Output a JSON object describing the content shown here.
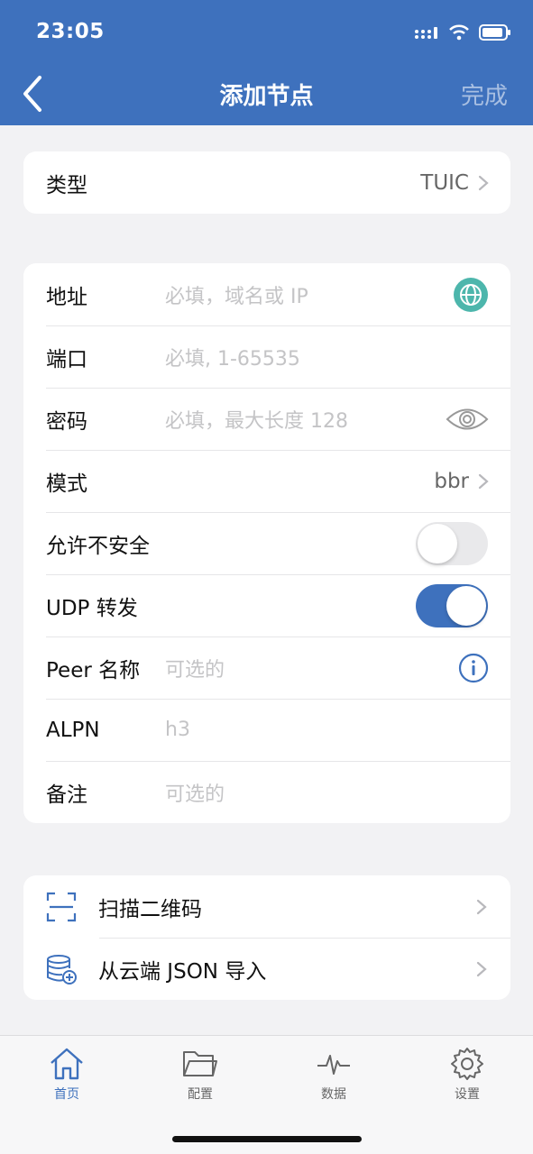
{
  "status": {
    "time": "23:05"
  },
  "header": {
    "title": "添加节点",
    "done_label": "完成"
  },
  "type_card": {
    "label": "类型",
    "value": "TUIC"
  },
  "form": {
    "address": {
      "label": "地址",
      "placeholder": "必填，域名或 IP"
    },
    "port": {
      "label": "端口",
      "placeholder": "必填, 1-65535"
    },
    "password": {
      "label": "密码",
      "placeholder": "必填，最大长度 128"
    },
    "mode": {
      "label": "模式",
      "value": "bbr"
    },
    "insecure": {
      "label": "允许不安全",
      "enabled": false
    },
    "udp": {
      "label": "UDP 转发",
      "enabled": true
    },
    "peer": {
      "label": "Peer 名称",
      "placeholder": "可选的"
    },
    "alpn": {
      "label": "ALPN",
      "placeholder": "h3"
    },
    "note": {
      "label": "备注",
      "placeholder": "可选的"
    }
  },
  "actions": {
    "scan": {
      "label": "扫描二维码"
    },
    "import_json": {
      "label": "从云端 JSON 导入"
    }
  },
  "tabs": [
    {
      "label": "首页",
      "icon": "home-icon",
      "active": true
    },
    {
      "label": "配置",
      "icon": "folder-icon",
      "active": false
    },
    {
      "label": "数据",
      "icon": "pulse-icon",
      "active": false
    },
    {
      "label": "设置",
      "icon": "gear-icon",
      "active": false
    }
  ],
  "colors": {
    "accent": "#3e71bd",
    "globe": "#4db6ac"
  }
}
